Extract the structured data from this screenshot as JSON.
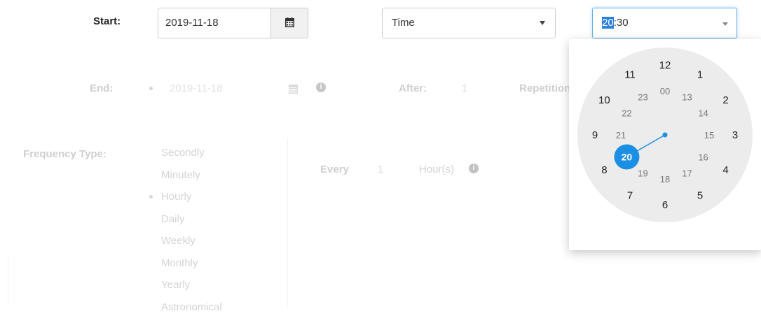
{
  "start": {
    "label": "Start:",
    "date_value": "2019-11-18",
    "calendar_icon": "calendar-icon"
  },
  "type_select": {
    "value": "Time"
  },
  "time_input": {
    "hour": "20",
    "rest": ":30",
    "caret_icon": "chevron-down-icon"
  },
  "end": {
    "label": "End:",
    "date_value": "2019-11-18",
    "info_icon": "info-icon",
    "after_label": "After:",
    "after_value": "1",
    "repetitions_label": "Repetitions"
  },
  "frequency": {
    "label": "Frequency Type:",
    "options": [
      "Secondly",
      "Minutely",
      "Hourly",
      "Daily",
      "Weekly",
      "Monthly",
      "Yearly",
      "Astronomical"
    ],
    "selected": "Hourly",
    "every_label": "Every",
    "every_value": "1",
    "unit_label": "Hour(s)"
  },
  "clock": {
    "selected_hour": 20,
    "minute": 30,
    "outer_hours": [
      12,
      1,
      2,
      3,
      4,
      5,
      6,
      7,
      8,
      9,
      10,
      11
    ],
    "inner_hours": [
      "00",
      13,
      14,
      15,
      16,
      17,
      18,
      19,
      20,
      21,
      22,
      23
    ],
    "colors": {
      "accent": "#1a8fe3",
      "face": "#ececec"
    }
  }
}
